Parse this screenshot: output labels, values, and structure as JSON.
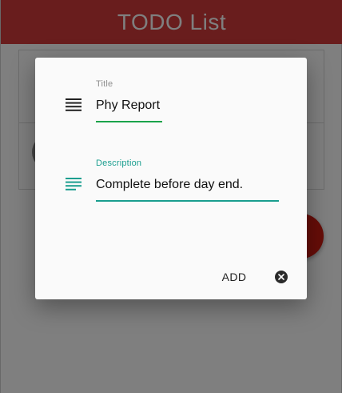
{
  "app": {
    "title": "TODO List"
  },
  "dialog": {
    "title_field": {
      "label": "Title",
      "value": "Phy Report",
      "icon": "subject-icon"
    },
    "description_field": {
      "label": "Description",
      "value": "Complete before day end.",
      "icon": "notes-icon"
    },
    "add_label": "ADD",
    "close_icon": "close-circle-icon"
  },
  "colors": {
    "app_bar": "#d23a3a",
    "title_underline": "#1aa34a",
    "accent": "#1a9e8f",
    "fab": "#cc1a10"
  }
}
